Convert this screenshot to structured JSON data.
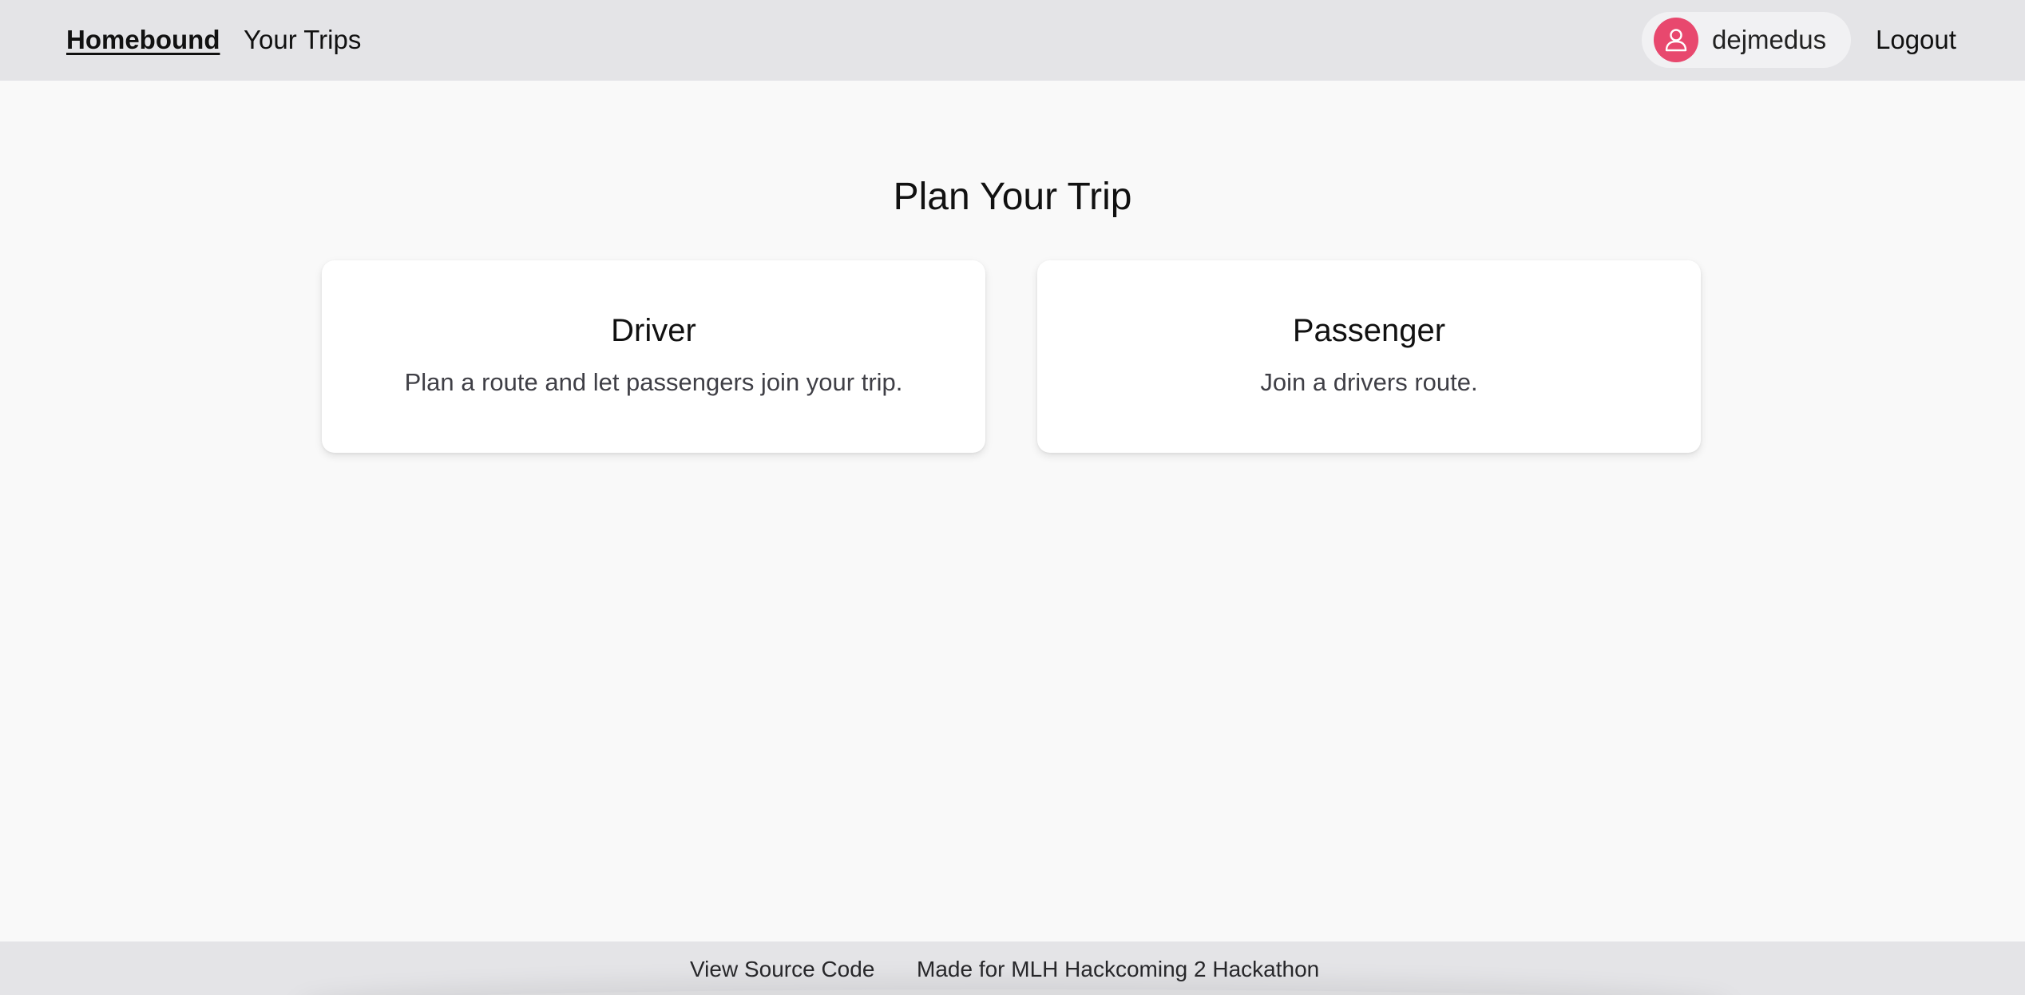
{
  "header": {
    "brand": "Homebound",
    "nav_trips": "Your Trips",
    "username": "dejmedus",
    "logout": "Logout",
    "avatar_icon": "user-icon",
    "avatar_color": "#e8486e"
  },
  "main": {
    "title": "Plan Your Trip",
    "cards": [
      {
        "title": "Driver",
        "description": "Plan a route and let passengers join your trip."
      },
      {
        "title": "Passenger",
        "description": "Join a drivers route."
      }
    ]
  },
  "footer": {
    "source_link": "View Source Code",
    "made_for": "Made for MLH Hackcoming 2 Hackathon"
  }
}
